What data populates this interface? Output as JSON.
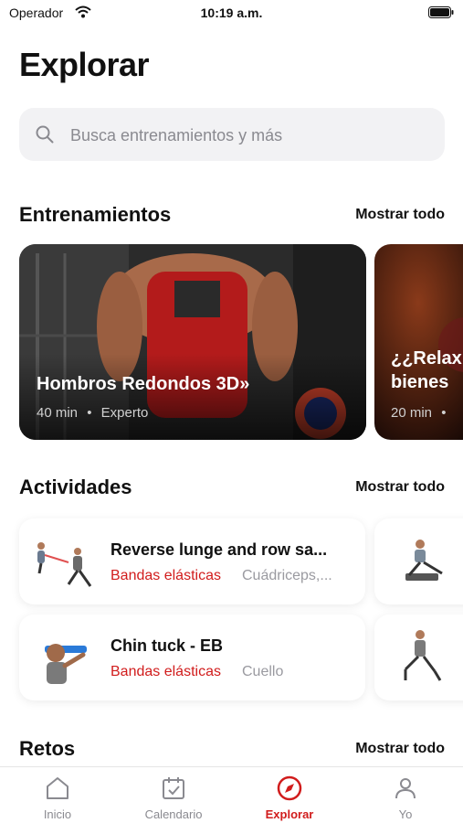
{
  "status_bar": {
    "carrier": "Operador",
    "time": "10:19 a.m."
  },
  "page_title": "Explorar",
  "search": {
    "placeholder": "Busca entrenamientos y más"
  },
  "workouts_section": {
    "title": "Entrenamientos",
    "show_all": "Mostrar todo",
    "cards": [
      {
        "title": "Hombros Redondos 3D»",
        "duration": "40 min",
        "separator": "•",
        "level": "Experto"
      },
      {
        "title": "¿¿Relax { bienes",
        "duration": "20 min",
        "separator": "•",
        "level": ""
      }
    ]
  },
  "activities_section": {
    "title": "Actividades",
    "show_all": "Mostrar todo",
    "items": [
      {
        "title": "Reverse lunge and row sa...",
        "equipment": "Bandas elásticas",
        "muscle": "Cuádriceps,..."
      },
      {
        "title": "Chin tuck - EB",
        "equipment": "Bandas elásticas",
        "muscle": "Cuello"
      }
    ]
  },
  "challenges_section": {
    "title": "Retos",
    "show_all": "Mostrar todo"
  },
  "tabbar": {
    "tabs": [
      {
        "label": "Inicio",
        "icon": "home-icon",
        "active": false
      },
      {
        "label": "Calendario",
        "icon": "calendar-icon",
        "active": false
      },
      {
        "label": "Explorar",
        "icon": "compass-icon",
        "active": true
      },
      {
        "label": "Yo",
        "icon": "person-icon",
        "active": false
      }
    ]
  },
  "colors": {
    "accent": "#d11c1c",
    "muted": "#8a8a90",
    "search_bg": "#f2f2f4"
  }
}
